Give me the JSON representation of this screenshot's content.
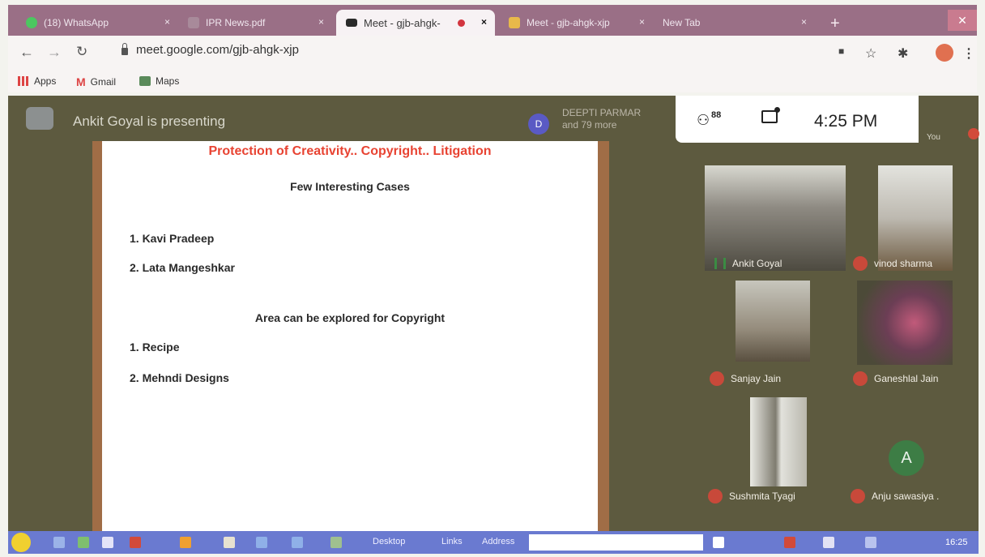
{
  "browser": {
    "tabs": [
      {
        "label": "(18) WhatsApp",
        "close": "×"
      },
      {
        "label": "IPR News.pdf",
        "close": "×"
      },
      {
        "label": "Meet - gjb-ahgk-",
        "close": "×"
      },
      {
        "label": "Meet - gjb-ahgk-xjp",
        "close": "×"
      },
      {
        "label": "New Tab",
        "close": "×"
      }
    ],
    "new_tab": "+",
    "url": "meet.google.com/gjb-ahgk-xjp",
    "bookmarks": [
      "Apps",
      "Gmail",
      "Maps"
    ]
  },
  "meet": {
    "presenting": "Ankit Goyal is presenting",
    "presenter_avatar": "D",
    "presenter_line1": "DEEPTI PARMAR",
    "presenter_line2": "and 79 more",
    "people_count": "88",
    "time": "4:25 PM",
    "you_label": "You",
    "participants": [
      {
        "name": "Ankit Goyal"
      },
      {
        "name": "vinod sharma"
      },
      {
        "name": "Sanjay Jain"
      },
      {
        "name": "Ganeshlal Jain"
      },
      {
        "name": "Sushmita Tyagi"
      },
      {
        "name": "Anju sawasiya ."
      }
    ],
    "anju_avatar": "A"
  },
  "slide": {
    "title": "Protection of Creativity.. Copyright.. Litigation",
    "heading1": "Few Interesting Cases",
    "item1": "1. Kavi Pradeep",
    "item2": "2. Lata Mangeshkar",
    "heading2": "Area can be explored for Copyright",
    "item3": "1. Recipe",
    "item4": "2. Mehndi Designs"
  },
  "taskbar": {
    "desktop": "Desktop",
    "links": "Links",
    "address": "Address",
    "clock": "16:25"
  }
}
